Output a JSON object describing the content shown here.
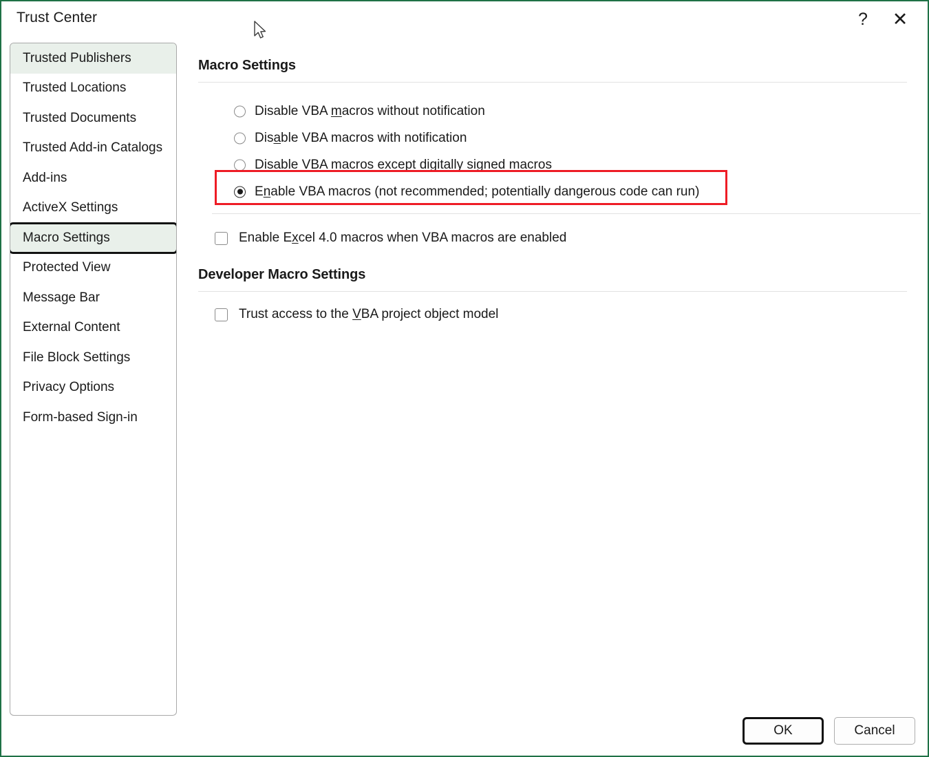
{
  "window": {
    "title": "Trust Center",
    "help_glyph": "?",
    "close_glyph": "✕",
    "accent_color": "#1e7145",
    "highlight_color": "#ee1c25"
  },
  "sidebar": {
    "items": [
      {
        "label": "Trusted Publishers",
        "state": "hover"
      },
      {
        "label": "Trusted Locations",
        "state": "normal"
      },
      {
        "label": "Trusted Documents",
        "state": "normal"
      },
      {
        "label": "Trusted Add-in Catalogs",
        "state": "normal"
      },
      {
        "label": "Add-ins",
        "state": "normal"
      },
      {
        "label": "ActiveX Settings",
        "state": "normal"
      },
      {
        "label": "Macro Settings",
        "state": "selected"
      },
      {
        "label": "Protected View",
        "state": "normal"
      },
      {
        "label": "Message Bar",
        "state": "normal"
      },
      {
        "label": "External Content",
        "state": "normal"
      },
      {
        "label": "File Block Settings",
        "state": "normal"
      },
      {
        "label": "Privacy Options",
        "state": "normal"
      },
      {
        "label": "Form-based Sign-in",
        "state": "normal"
      }
    ]
  },
  "main": {
    "macro_settings_title": "Macro Settings",
    "radio_options": [
      {
        "pre": "Disable VBA ",
        "acc": "m",
        "post": "acros without notification",
        "full": "Disable VBA macros without notification",
        "checked": false
      },
      {
        "pre": "Dis",
        "acc": "a",
        "post": "ble VBA macros with notification",
        "full": "Disable VBA macros with notification",
        "checked": false
      },
      {
        "pre": "Disable VBA macros except di",
        "acc": "g",
        "post": "itally signed macros",
        "full": "Disable VBA macros except digitally signed macros",
        "checked": false
      },
      {
        "pre": "E",
        "acc": "n",
        "post": "able VBA macros (not recommended; potentially dangerous code can run)",
        "full": "Enable VBA macros (not recommended; potentially dangerous code can run)",
        "checked": true
      }
    ],
    "excel4_checkbox": {
      "pre": "Enable E",
      "acc": "x",
      "post": "cel 4.0 macros when VBA macros are enabled",
      "full": "Enable Excel 4.0 macros when VBA macros are enabled",
      "checked": false
    },
    "developer_title": "Developer Macro Settings",
    "vba_checkbox": {
      "pre": "Trust access to the ",
      "acc": "V",
      "post": "BA project object model",
      "full": "Trust access to the VBA project object model",
      "checked": false
    }
  },
  "footer": {
    "ok_label": "OK",
    "cancel_label": "Cancel"
  }
}
